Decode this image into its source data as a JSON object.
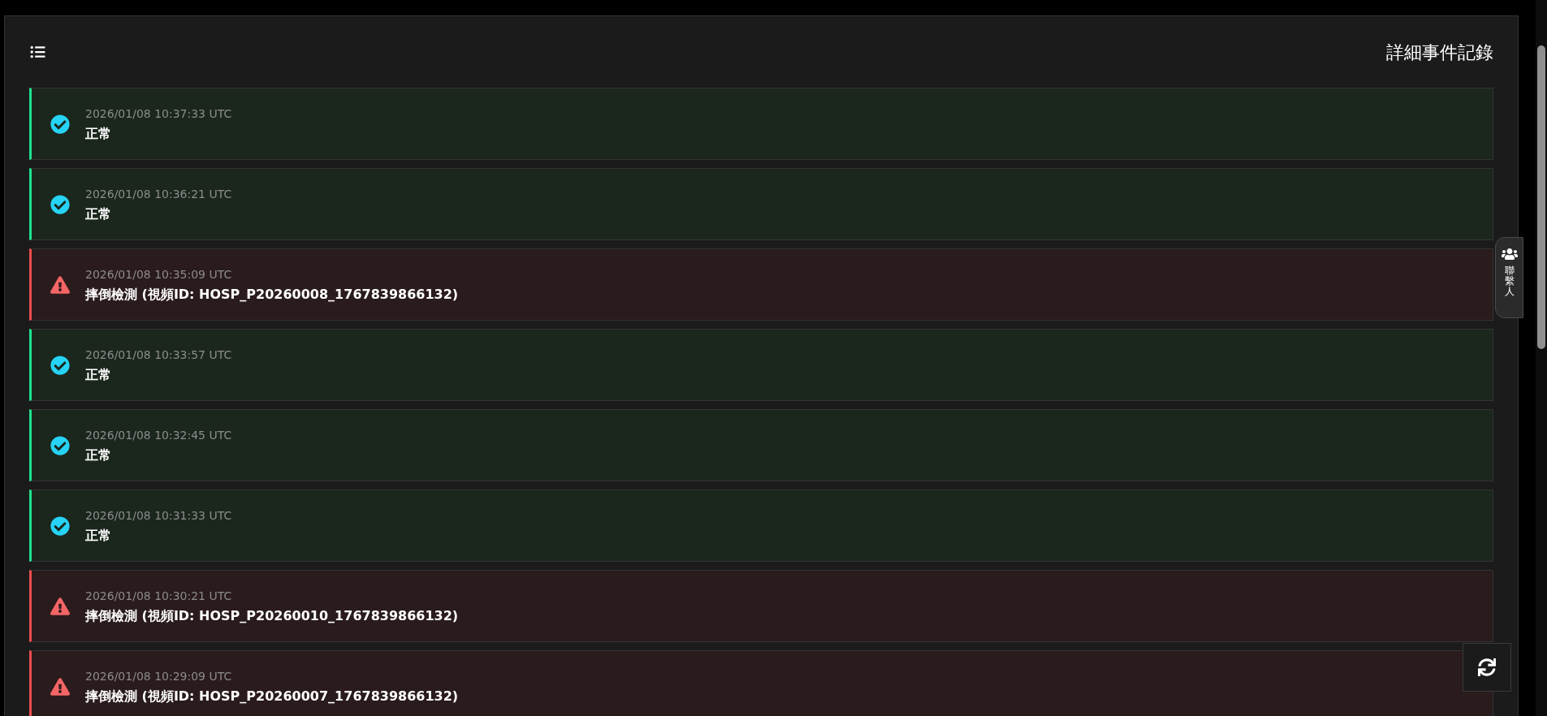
{
  "header": {
    "title": "詳細事件記錄"
  },
  "events": [
    {
      "kind": "normal",
      "time": "2026/01/08 10:37:33 UTC",
      "message": "正常"
    },
    {
      "kind": "normal",
      "time": "2026/01/08 10:36:21 UTC",
      "message": "正常"
    },
    {
      "kind": "alert",
      "time": "2026/01/08 10:35:09 UTC",
      "message": "摔倒檢測 (視頻ID: HOSP_P20260008_1767839866132)"
    },
    {
      "kind": "normal",
      "time": "2026/01/08 10:33:57 UTC",
      "message": "正常"
    },
    {
      "kind": "normal",
      "time": "2026/01/08 10:32:45 UTC",
      "message": "正常"
    },
    {
      "kind": "normal",
      "time": "2026/01/08 10:31:33 UTC",
      "message": "正常"
    },
    {
      "kind": "alert",
      "time": "2026/01/08 10:30:21 UTC",
      "message": "摔倒檢測 (視頻ID: HOSP_P20260010_1767839866132)"
    },
    {
      "kind": "alert",
      "time": "2026/01/08 10:29:09 UTC",
      "message": "摔倒檢測 (視頻ID: HOSP_P20260007_1767839866132)"
    }
  ],
  "contact_tab": {
    "label": "聯繫人"
  }
}
